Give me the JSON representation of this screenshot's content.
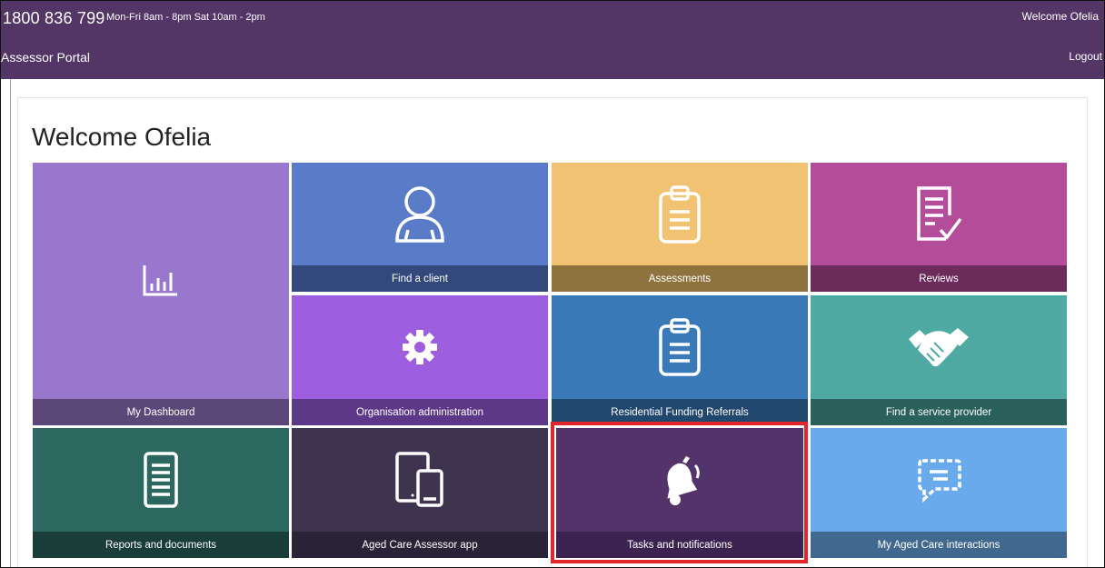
{
  "header": {
    "phone": "1800 836 799",
    "hours": "Mon-Fri 8am - 8pm Sat 10am - 2pm",
    "welcome": "Welcome Ofelia",
    "portal_name": "Assessor Portal",
    "logout": "Logout"
  },
  "page": {
    "title": "Welcome Ofelia"
  },
  "tiles": {
    "dashboard": "My Dashboard",
    "find_client": "Find a client",
    "assessments": "Assessments",
    "reviews": "Reviews",
    "org_admin": "Organisation administration",
    "residential": "Residential Funding Referrals",
    "find_provider": "Find a service provider",
    "reports": "Reports and documents",
    "assessor_app": "Aged Care Assessor app",
    "tasks": "Tasks and notifications",
    "interactions": "My Aged Care interactions"
  },
  "colors": {
    "header": "#533566",
    "highlight": "#e2262b"
  }
}
